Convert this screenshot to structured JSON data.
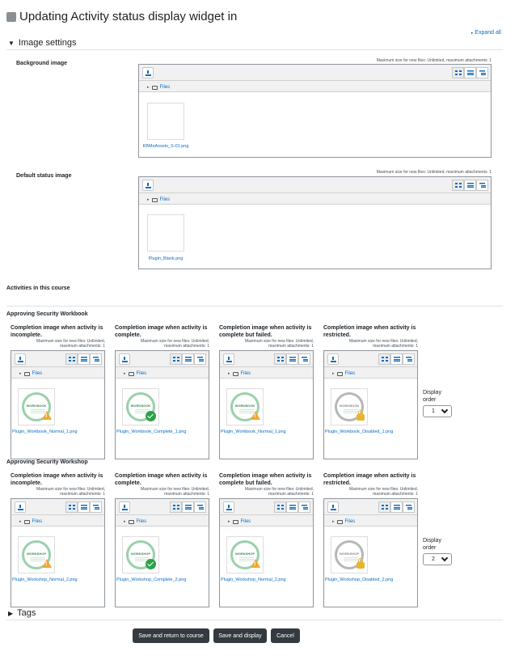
{
  "page": {
    "title": "Updating Activity status display widget in"
  },
  "header": {
    "expand_all": "Expand all"
  },
  "image_settings": {
    "section_label": "Image settings",
    "max_size_text": "Maximum size for new files: Unlimited, maximum attachments: 1",
    "files_label": "Files",
    "background": {
      "label": "Background image",
      "file": "KBMeAssets_S-01.png"
    },
    "default_status": {
      "label": "Default status image",
      "file": "Plugin_Blank.png"
    }
  },
  "activities": {
    "section_label": "Activities in this course",
    "col_labels": [
      "Completion image when activity is incomplete.",
      "Completion image when activity is complete.",
      "Completion image when activity is complete but failed.",
      "Completion image when activity is restricted."
    ],
    "max_size_text": "Maximum size for new files: Unlimited, maximum attachments: 1",
    "files_label": "Files",
    "display_order_label": "Display order",
    "items": [
      {
        "name": "Approving Security Workbook",
        "badge_text": "WORKBOOK",
        "files": [
          "Plugin_Workbook_Normal_1.png",
          "Plugin_Workbook_Complete_1.png",
          "Plugin_Workbook_Normal_1.png",
          "Plugin_Workbook_Disabled_1.png"
        ],
        "display_order": "1"
      },
      {
        "name": "Approving Security Workshop",
        "badge_text": "WORKSHOP",
        "files": [
          "Plugin_Workshop_Normal_2.png",
          "Plugin_Workshop_Complete_2.png",
          "Plugin_Workshop_Normal_2.png",
          "Plugin_Workshop_Disabled_2.png"
        ],
        "display_order": "2"
      }
    ]
  },
  "tags": {
    "section_label": "Tags"
  },
  "buttons": {
    "save_return": "Save and return to course",
    "save_display": "Save and display",
    "cancel": "Cancel"
  },
  "colors": {
    "link": "#0f6cbf",
    "badge_green": "#9ad1aa",
    "badge_grey": "#b7b7b7",
    "button_dark": "#343a40"
  }
}
